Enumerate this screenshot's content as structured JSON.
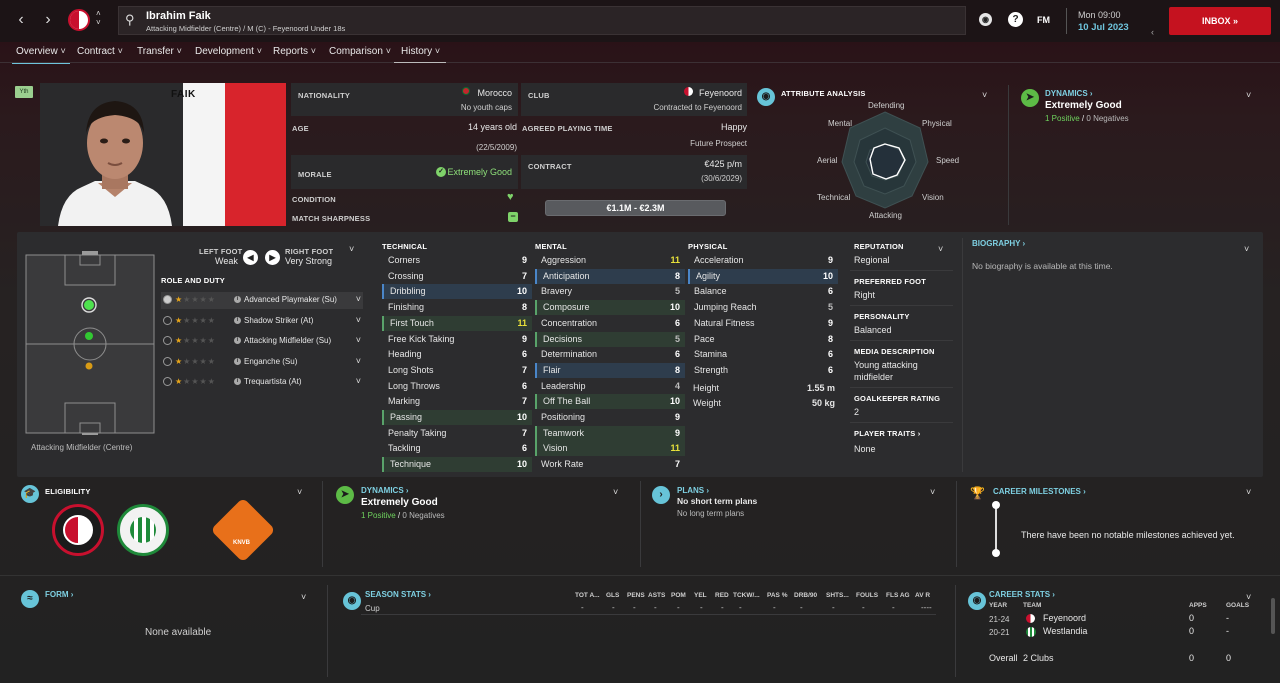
{
  "header": {
    "player_name": "Ibrahim Faik",
    "player_subtitle": "Attacking Midfielder (Centre) / M (C) - Feyenoord Under 18s",
    "day_time": "Mon 09:00",
    "date": "10 Jul 2023",
    "inbox_label": "INBOX",
    "fm_label": "FM"
  },
  "tabs": [
    "Overview",
    "Contract",
    "Transfer",
    "Development",
    "Reports",
    "Comparison",
    "History"
  ],
  "active_tab": "Overview",
  "profile": {
    "age_badge": "Yth",
    "shirt_name": "FAIK",
    "nationality_label": "NATIONALITY",
    "nationality": "Morocco",
    "youth_caps": "No youth caps",
    "club_label": "CLUB",
    "club": "Feyenoord",
    "club_contract": "Contracted to Feyenoord",
    "age_label": "AGE",
    "age": "14 years old",
    "dob": "(22/5/2009)",
    "playing_time_label": "AGREED PLAYING TIME",
    "playing_time_mood": "Happy",
    "playing_time": "Future Prospect",
    "contract_label": "CONTRACT",
    "wage": "€425 p/m",
    "contract_end": "(30/6/2029)",
    "morale_label": "MORALE",
    "morale": "Extremely Good",
    "condition_label": "CONDITION",
    "sharpness_label": "MATCH SHARPNESS",
    "value_range": "€1.1M - €2.3M"
  },
  "attribute_analysis": {
    "title": "ATTRIBUTE ANALYSIS",
    "axes": [
      "Defending",
      "Physical",
      "Speed",
      "Vision",
      "Attacking",
      "Technical",
      "Aerial",
      "Mental"
    ]
  },
  "dynamics_top": {
    "title": "DYNAMICS",
    "value": "Extremely Good",
    "positives": "1 Positive",
    "sep": "/",
    "negatives": "0 Negatives"
  },
  "pitch": {
    "position_label": "Attacking Midfielder (Centre)",
    "left_foot_label": "LEFT FOOT",
    "left_foot": "Weak",
    "right_foot_label": "RIGHT FOOT",
    "right_foot": "Very Strong",
    "role_title": "ROLE AND DUTY",
    "roles": [
      {
        "name": "Advanced Playmaker (Su)"
      },
      {
        "name": "Shadow Striker (At)"
      },
      {
        "name": "Attacking Midfielder (Su)"
      },
      {
        "name": "Enganche (Su)"
      },
      {
        "name": "Trequartista (At)"
      }
    ]
  },
  "technical": {
    "title": "TECHNICAL",
    "rows": [
      {
        "name": "Corners",
        "v": "9",
        "h": ""
      },
      {
        "name": "Crossing",
        "v": "7",
        "h": ""
      },
      {
        "name": "Dribbling",
        "v": "10",
        "h": "blue"
      },
      {
        "name": "Finishing",
        "v": "8",
        "h": ""
      },
      {
        "name": "First Touch",
        "v": "11",
        "h": "green"
      },
      {
        "name": "Free Kick Taking",
        "v": "9",
        "h": ""
      },
      {
        "name": "Heading",
        "v": "6",
        "h": ""
      },
      {
        "name": "Long Shots",
        "v": "7",
        "h": ""
      },
      {
        "name": "Long Throws",
        "v": "6",
        "h": ""
      },
      {
        "name": "Marking",
        "v": "7",
        "h": ""
      },
      {
        "name": "Passing",
        "v": "10",
        "h": "green"
      },
      {
        "name": "Penalty Taking",
        "v": "7",
        "h": ""
      },
      {
        "name": "Tackling",
        "v": "6",
        "h": ""
      },
      {
        "name": "Technique",
        "v": "10",
        "h": "green"
      }
    ]
  },
  "mental": {
    "title": "MENTAL",
    "rows": [
      {
        "name": "Aggression",
        "v": "11",
        "h": ""
      },
      {
        "name": "Anticipation",
        "v": "8",
        "h": "blue"
      },
      {
        "name": "Bravery",
        "v": "5",
        "h": ""
      },
      {
        "name": "Composure",
        "v": "10",
        "h": "green"
      },
      {
        "name": "Concentration",
        "v": "6",
        "h": ""
      },
      {
        "name": "Decisions",
        "v": "5",
        "h": "green"
      },
      {
        "name": "Determination",
        "v": "6",
        "h": ""
      },
      {
        "name": "Flair",
        "v": "8",
        "h": "blue"
      },
      {
        "name": "Leadership",
        "v": "4",
        "h": ""
      },
      {
        "name": "Off The Ball",
        "v": "10",
        "h": "green"
      },
      {
        "name": "Positioning",
        "v": "9",
        "h": ""
      },
      {
        "name": "Teamwork",
        "v": "9",
        "h": "green"
      },
      {
        "name": "Vision",
        "v": "11",
        "h": "green"
      },
      {
        "name": "Work Rate",
        "v": "7",
        "h": ""
      }
    ]
  },
  "physical": {
    "title": "PHYSICAL",
    "rows": [
      {
        "name": "Acceleration",
        "v": "9",
        "h": ""
      },
      {
        "name": "Agility",
        "v": "10",
        "h": "blue"
      },
      {
        "name": "Balance",
        "v": "6",
        "h": ""
      },
      {
        "name": "Jumping Reach",
        "v": "5",
        "h": ""
      },
      {
        "name": "Natural Fitness",
        "v": "9",
        "h": ""
      },
      {
        "name": "Pace",
        "v": "8",
        "h": ""
      },
      {
        "name": "Stamina",
        "v": "6",
        "h": ""
      },
      {
        "name": "Strength",
        "v": "6",
        "h": ""
      }
    ],
    "height_label": "Height",
    "height": "1.55 m",
    "weight_label": "Weight",
    "weight": "50 kg"
  },
  "info": {
    "reputation_label": "REPUTATION",
    "reputation": "Regional",
    "pref_foot_label": "PREFERRED FOOT",
    "pref_foot": "Right",
    "personality_label": "PERSONALITY",
    "personality": "Balanced",
    "media_label": "MEDIA DESCRIPTION",
    "media_line1": "Young attacking",
    "media_line2": "midfielder",
    "gk_label": "GOALKEEPER RATING",
    "gk": "2",
    "traits_label": "PLAYER TRAITS",
    "traits": "None"
  },
  "biography": {
    "title": "BIOGRAPHY",
    "text": "No biography is available at this time."
  },
  "eligibility": {
    "title": "ELIGIBILITY",
    "knvb": "KNVB"
  },
  "dynamics_bottom": {
    "title": "DYNAMICS",
    "value": "Extremely Good",
    "positives": "1 Positive",
    "sep": "/",
    "negatives": "0 Negatives"
  },
  "plans": {
    "title": "PLANS",
    "short": "No short term plans",
    "long": "No long term plans"
  },
  "milestones": {
    "title": "CAREER MILESTONES",
    "text": "There have been no notable milestones achieved yet."
  },
  "form": {
    "title": "FORM",
    "text": "None available"
  },
  "season_stats": {
    "title": "SEASON STATS",
    "row_label": "Cup",
    "headers": [
      "TOT A...",
      "GLS",
      "PENS",
      "ASTS",
      "POM",
      "YEL",
      "RED",
      "TCKW/...",
      "PAS %",
      "DRB/90",
      "SHTS...",
      "FOULS",
      "FLS AG",
      "AV R"
    ],
    "values": [
      "-",
      "-",
      "-",
      "-",
      "-",
      "-",
      "-",
      "-",
      "-",
      "-",
      "-",
      "-",
      "-",
      "----"
    ]
  },
  "career_stats": {
    "title": "CAREER STATS",
    "h_year": "YEAR",
    "h_team": "TEAM",
    "h_apps": "APPS",
    "h_goals": "GOALS",
    "rows": [
      {
        "year": "21-24",
        "team": "Feyenoord",
        "apps": "0",
        "goals": "-"
      },
      {
        "year": "20-21",
        "team": "Westlandia",
        "apps": "0",
        "goals": "-"
      }
    ],
    "overall_label": "Overall",
    "overall_team": "2 Clubs",
    "overall_apps": "0",
    "overall_goals": "0"
  },
  "colors": {
    "accent": "#67c4d8",
    "positive": "#5dbb46",
    "inbox": "#c5121f",
    "highlight": "#e8e23a"
  }
}
